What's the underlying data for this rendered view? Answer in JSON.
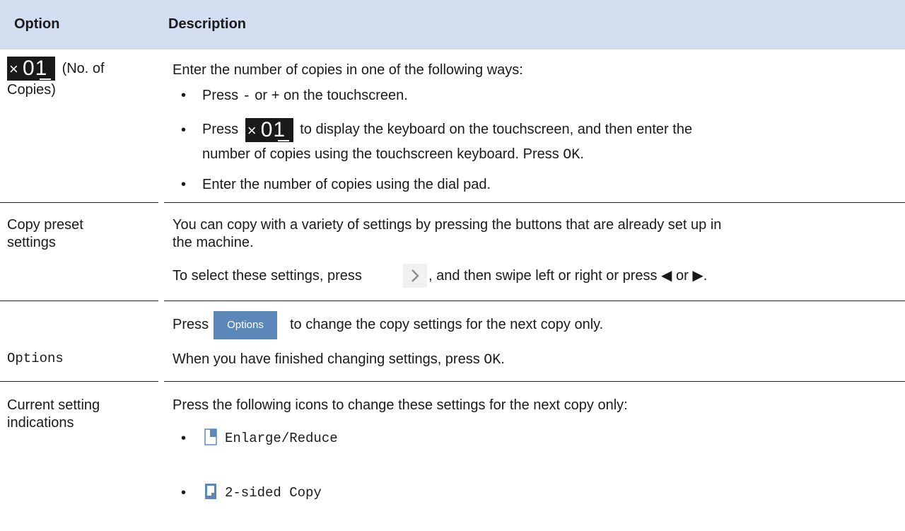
{
  "header": {
    "col_option": "Option",
    "col_description": "Description"
  },
  "rows": [
    {
      "option_suffix_line1": "(No. of",
      "option_line2": "Copies)",
      "badge": {
        "x": "×",
        "num": "01"
      },
      "intro": "Enter the number of copies in one of the following ways:",
      "bullets": {
        "b1": {
          "a": "Press ",
          "minus": "-",
          "b": " or ",
          "plus": "+",
          "c": " on the touchscreen."
        },
        "b2": {
          "a": "Press",
          "b": "to display the keyboard on the touchscreen, and then enter the",
          "line2": "number of copies using the touchscreen keyboard. Press ",
          "ok": "OK",
          "end": "."
        },
        "b3": "Enter the number of copies using the dial pad."
      }
    },
    {
      "option_line1": "Copy preset",
      "option_line2": "settings",
      "desc_line1": "You can copy with a variety of settings by pressing the buttons that are already set up in",
      "desc_line2": "the machine.",
      "desc2_a": "To select these settings, press",
      "desc2_b": ", and then swipe left or right or press ◀ or ▶."
    },
    {
      "option": "Options",
      "desc1_a": "Press",
      "button_label": "Options",
      "desc1_b": "to change the copy settings for the next copy only.",
      "desc2_a": "When you have finished changing settings, press ",
      "ok": "OK",
      "desc2_end": "."
    },
    {
      "option_line1": "Current setting",
      "option_line2": "indications",
      "desc": "Press the following icons to change these settings for the next copy only:",
      "items": [
        "Enlarge/Reduce",
        "2-sided Copy"
      ]
    }
  ],
  "icons": {
    "chevron": "chevron-right-icon",
    "enlarge": "enlarge-reduce-icon",
    "two_sided": "two-sided-copy-icon"
  },
  "colors": {
    "header_bg": "#d3dff0",
    "options_button": "#5b88b8",
    "badge_bg": "#1a1a1a"
  }
}
